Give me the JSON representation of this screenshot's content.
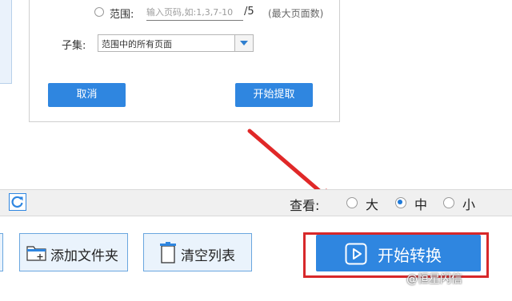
{
  "dialog": {
    "range_label": "范围:",
    "range_placeholder": "输入页码,如:1,3,7-10",
    "range_total": "/5",
    "range_hint": "(最大页面数)",
    "subset_label": "子集:",
    "subset_value": "范围中的所有页面",
    "cancel_label": "取消",
    "start_extract_label": "开始提取"
  },
  "view_bar": {
    "view_label": "查看:",
    "options": [
      {
        "label": "大",
        "selected": false
      },
      {
        "label": "中",
        "selected": true
      },
      {
        "label": "小",
        "selected": false
      }
    ]
  },
  "toolbar": {
    "add_folder_label": "添加文件夹",
    "clear_list_label": "清空列表",
    "start_convert_label": "开始转换"
  },
  "watermark": "@恒星闪信",
  "colors": {
    "accent": "#2f86e0",
    "highlight": "#d7282a"
  }
}
